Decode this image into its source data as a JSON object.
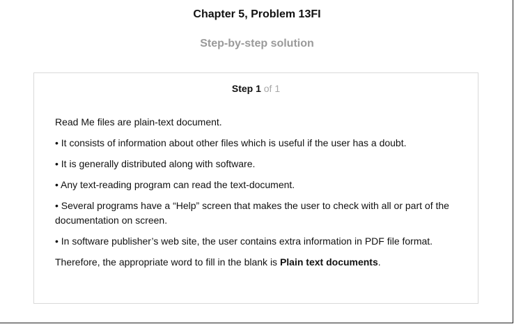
{
  "header": {
    "title": "Chapter 5, Problem 13FI",
    "subtitle": "Step-by-step solution"
  },
  "step": {
    "label": "Step 1",
    "total": "of 1",
    "intro": "Read Me files are plain-text document.",
    "bullets": [
      "• It consists of information about other files which is useful if the user has a doubt.",
      "• It is generally distributed along with software.",
      "• Any text-reading program can read the text-document.",
      "• Several programs have a “Help” screen that makes the user to check with all or part of the documentation on screen.",
      "• In software publisher’s web site, the user contains extra information in PDF file format."
    ],
    "conclusion_prefix": "Therefore, the appropriate word to fill in the blank is ",
    "conclusion_answer": "Plain text documents",
    "conclusion_suffix": "."
  }
}
